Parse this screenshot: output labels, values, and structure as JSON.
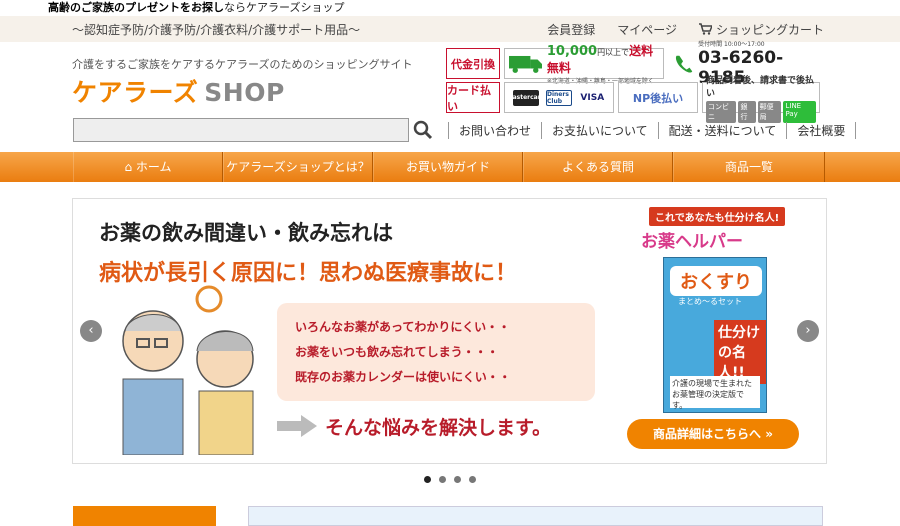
{
  "topbar": {
    "lead": "高齢のご家族のプレゼントをお探し",
    "rest": "ならケアラーズショップ"
  },
  "subbar": {
    "categories": "～認知症予防/介護予防/介護衣料/介護サポート用品～",
    "member_label": "会員登録",
    "mypage_label": "マイページ",
    "cart_label": "ショッピングカート"
  },
  "header": {
    "tagline": "介護をするご家族をケアするケアラーズのためのショッピングサイト",
    "logo_main": "ケアラーズ",
    "logo_sub": "SHOP",
    "cod_label": "代金引換",
    "shipping_amount": "10,000",
    "shipping_unit": "円以上で",
    "shipping_free": "送料無料",
    "shipping_note": "※北海道・沖縄・離島・一部地域を除く",
    "phone_hours": "受付時間 10:00～17:00",
    "phone": "03-6260-9185",
    "card_label": "カード払い",
    "card_brands": [
      "mastercard",
      "Diners Club",
      "VISA"
    ],
    "np_label": "NP後払い",
    "np_note": "商品到着後、請求書で後払い",
    "np_methods": [
      "コンビニ",
      "銀行",
      "郵便局",
      "LINE Pay"
    ]
  },
  "search": {
    "placeholder": ""
  },
  "sublinks": [
    "お問い合わせ",
    "お支払いについて",
    "配送・送料について",
    "会社概要"
  ],
  "nav": [
    "ホーム",
    "ケアラーズショップとは？",
    "お買い物ガイド",
    "よくある質問",
    "商品一覧"
  ],
  "banner": {
    "headline": "お薬の飲み間違い・飲み忘れは",
    "subhead": "病状が長引く原因に！思わぬ医療事故に！",
    "problems": [
      "いろんなお薬があってわかりにくい・・",
      "お薬をいつも飲み忘れてしまう・・・",
      "既存のお薬カレンダーは使いにくい・・"
    ],
    "resolve": "そんな悩みを解決します。",
    "tag": "これであなたも仕分け名人!",
    "brand": "お薬ヘルパー",
    "product_title": "おくすり",
    "product_sub": "まとめ～るセット",
    "product_badge": "仕分けの名人!!",
    "product_note": "介護の現場で生まれたお薬管理の決定版です。",
    "detail_button": "商品詳細はこちらへ »"
  },
  "carousel": {
    "dots": 4,
    "active": 1
  },
  "colors": {
    "brand_orange": "#f08300",
    "accent_red": "#c8102e",
    "nav_orange": "#ea7d10"
  }
}
